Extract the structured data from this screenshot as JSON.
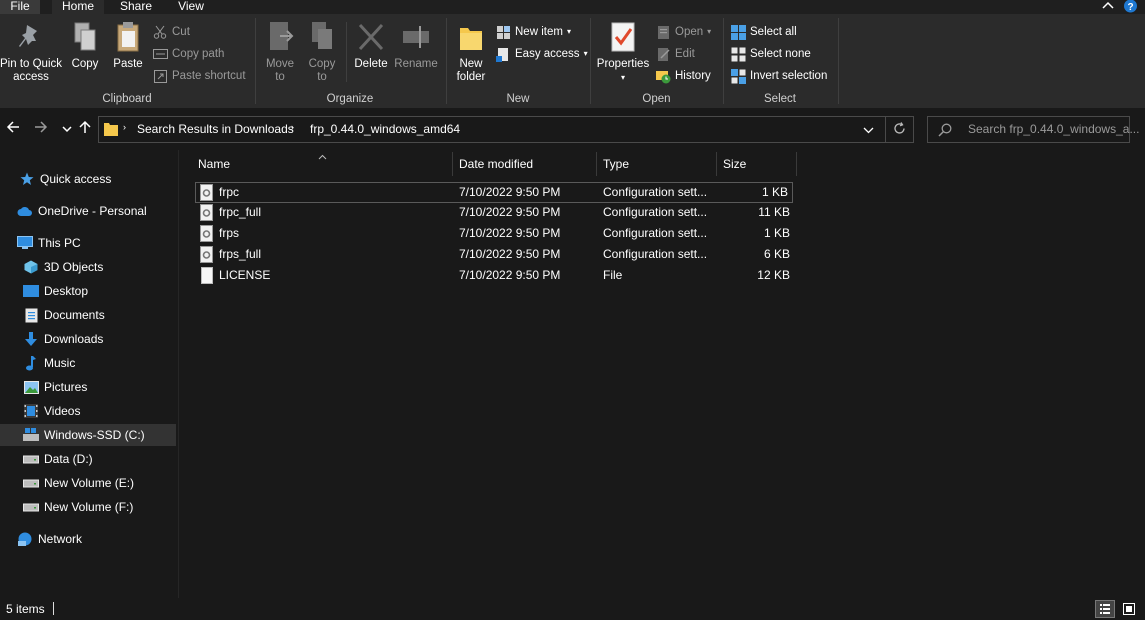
{
  "tabs": {
    "file": "File",
    "home": "Home",
    "share": "Share",
    "view": "View"
  },
  "ribbon": {
    "clipboard": {
      "label": "Clipboard",
      "pin_label_1": "Pin to Quick",
      "pin_label_2": "access",
      "copy": "Copy",
      "paste": "Paste",
      "cut": "Cut",
      "copy_path": "Copy path",
      "paste_shortcut": "Paste shortcut"
    },
    "organize": {
      "label": "Organize",
      "move_1": "Move",
      "move_2": "to",
      "copy_1": "Copy",
      "copy_2": "to",
      "delete": "Delete",
      "rename": "Rename"
    },
    "new": {
      "label": "New",
      "new_folder_1": "New",
      "new_folder_2": "folder",
      "new_item": "New item",
      "easy_access": "Easy access"
    },
    "open": {
      "label": "Open",
      "properties": "Properties",
      "open": "Open",
      "edit": "Edit",
      "history": "History"
    },
    "select": {
      "label": "Select",
      "select_all": "Select all",
      "select_none": "Select none",
      "invert": "Invert selection"
    }
  },
  "address": {
    "crumb_1": "Search Results in Downloads",
    "crumb_2": "frp_0.44.0_windows_amd64"
  },
  "search": {
    "placeholder": "Search frp_0.44.0_windows_a..."
  },
  "nav": {
    "quick_access": "Quick access",
    "onedrive": "OneDrive - Personal",
    "this_pc": "This PC",
    "objects3d": "3D Objects",
    "desktop": "Desktop",
    "documents": "Documents",
    "downloads": "Downloads",
    "music": "Music",
    "pictures": "Pictures",
    "videos": "Videos",
    "windows_ssd": "Windows-SSD (C:)",
    "data_d": "Data (D:)",
    "new_volume_e": "New Volume (E:)",
    "new_volume_f": "New Volume (F:)",
    "network": "Network"
  },
  "columns": {
    "name": "Name",
    "date": "Date modified",
    "type": "Type",
    "size": "Size"
  },
  "files": [
    {
      "name": "frpc",
      "date": "7/10/2022 9:50 PM",
      "type": "Configuration sett...",
      "size": "1 KB"
    },
    {
      "name": "frpc_full",
      "date": "7/10/2022 9:50 PM",
      "type": "Configuration sett...",
      "size": "11 KB"
    },
    {
      "name": "frps",
      "date": "7/10/2022 9:50 PM",
      "type": "Configuration sett...",
      "size": "1 KB"
    },
    {
      "name": "frps_full",
      "date": "7/10/2022 9:50 PM",
      "type": "Configuration sett...",
      "size": "6 KB"
    },
    {
      "name": "LICENSE",
      "date": "7/10/2022 9:50 PM",
      "type": "File",
      "size": "12 KB"
    }
  ],
  "status": {
    "count": "5 items"
  },
  "colors": {
    "accent": "#0a84ff",
    "folder": "#f5c84c",
    "background": "#191919",
    "ribbon": "#2b2b2b"
  }
}
